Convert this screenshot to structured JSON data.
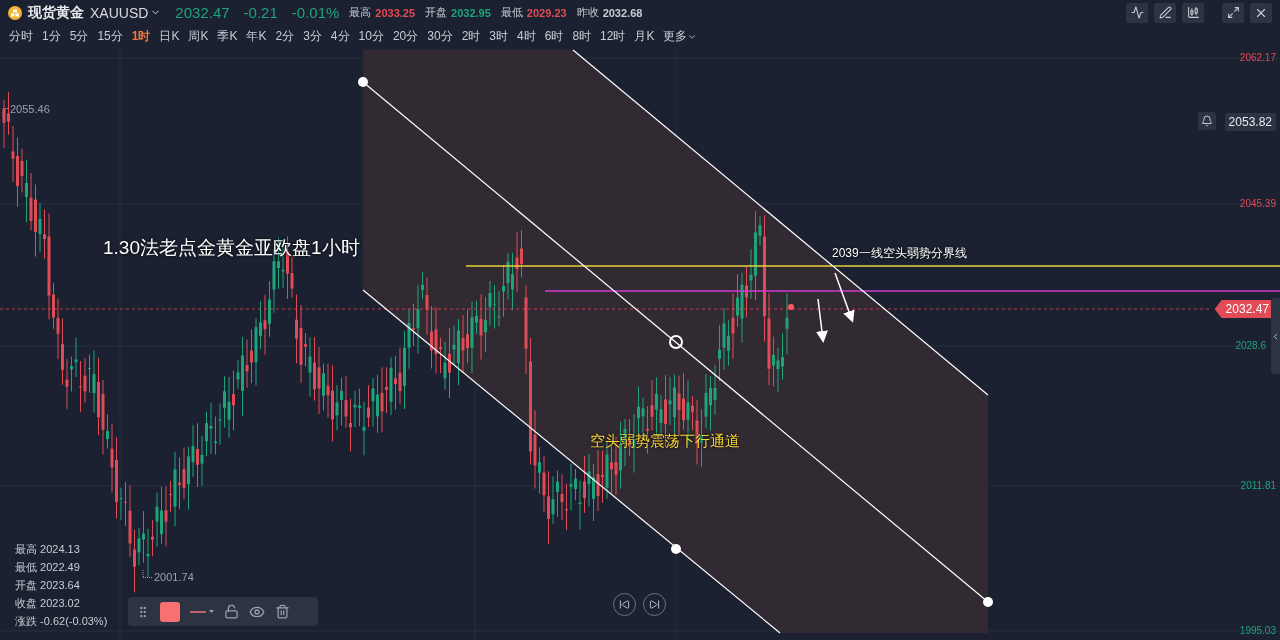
{
  "header": {
    "name": "现货黄金",
    "symbol": "XAUUSD",
    "price": "2032.47",
    "change": "-0.21",
    "change_pct": "-0.01%",
    "stats": [
      {
        "label": "最高",
        "value": "2033.25",
        "color": "#e04b55"
      },
      {
        "label": "开盘",
        "value": "2032.95",
        "color": "#1fa37a"
      },
      {
        "label": "最低",
        "value": "2029.23",
        "color": "#e04b55"
      },
      {
        "label": "昨收",
        "value": "2032.68",
        "color": "#c8ccd4"
      }
    ]
  },
  "intervals": [
    {
      "label": "分时",
      "selected": false
    },
    {
      "label": "1分",
      "selected": false
    },
    {
      "label": "5分",
      "selected": false
    },
    {
      "label": "15分",
      "selected": false
    },
    {
      "label": "1时",
      "selected": true
    },
    {
      "label": "日K",
      "selected": false
    },
    {
      "label": "周K",
      "selected": false
    },
    {
      "label": "季K",
      "selected": false
    },
    {
      "label": "年K",
      "selected": false
    },
    {
      "label": "2分",
      "selected": false
    },
    {
      "label": "3分",
      "selected": false
    },
    {
      "label": "4分",
      "selected": false
    },
    {
      "label": "10分",
      "selected": false
    },
    {
      "label": "20分",
      "selected": false
    },
    {
      "label": "30分",
      "selected": false
    },
    {
      "label": "2时",
      "selected": false
    },
    {
      "label": "3时",
      "selected": false
    },
    {
      "label": "4时",
      "selected": false
    },
    {
      "label": "6时",
      "selected": false
    },
    {
      "label": "8时",
      "selected": false
    },
    {
      "label": "12时",
      "selected": false
    },
    {
      "label": "月K",
      "selected": false
    }
  ],
  "more_label": "更多",
  "y_axis": [
    {
      "value": "2062.17",
      "color": "#e04b55"
    },
    {
      "value": "2045.39",
      "color": "#e04b55"
    },
    {
      "value": "2028.6",
      "color": "#1fa37a"
    },
    {
      "value": "2011.81",
      "color": "#1fa37a"
    },
    {
      "value": "1995.03",
      "color": "#1fa37a"
    }
  ],
  "current_price": "2032.47",
  "alert_price": "2053.82",
  "high_marker": "2055.46",
  "low_marker": "2001.74",
  "annotations": {
    "title": "1.30法老点金黄金亚欧盘1小时",
    "boundary_label": "2039一线空头弱势分界线",
    "channel_label": "空头弱势震荡下行通道"
  },
  "ohlc": [
    {
      "label": "最高",
      "value": "2024.13"
    },
    {
      "label": "最低",
      "value": "2022.49"
    },
    {
      "label": "开盘",
      "value": "2023.64"
    },
    {
      "label": "收盘",
      "value": "2023.02"
    },
    {
      "label": "涨跌",
      "value": "-0.62(-0.03%)"
    }
  ]
}
